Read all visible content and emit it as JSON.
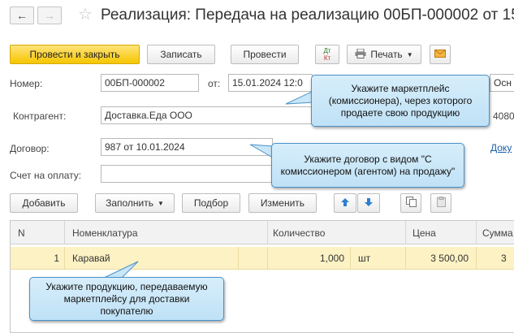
{
  "nav": {
    "back_icon": "arrow-left-icon",
    "forward_icon": "arrow-right-icon",
    "star_icon": "star-icon"
  },
  "window": {
    "title": "Реализация: Передача на реализацию 00БП-000002 от 15"
  },
  "toolbar": {
    "post_close_label": "Провести и закрыть",
    "save_label": "Записать",
    "post_label": "Провести",
    "dt_kt_top": "Дт",
    "dt_kt_bottom": "Кт",
    "print_label": "Печать",
    "print_icon": "printer-icon",
    "mail_icon": "envelope-icon"
  },
  "form": {
    "number_label": "Номер:",
    "number_value": "00БП-000002",
    "from_label": "от:",
    "date_value": "15.01.2024 12:0",
    "org_value": "Осн",
    "counterparty_label": "Контрагент:",
    "counterparty_value": "Доставка.Еда ООО",
    "counterparty_extra": "4080",
    "contract_label": "Договор:",
    "contract_value": "987 от 10.01.2024",
    "contract_link": "Доку",
    "invoice_label": "Счет на оплату:",
    "invoice_value": ""
  },
  "table_toolbar": {
    "add_label": "Добавить",
    "fill_label": "Заполнить",
    "select_label": "Подбор",
    "edit_label": "Изменить",
    "up_icon": "arrow-up-icon",
    "down_icon": "arrow-down-icon",
    "copy_icon": "copy-icon",
    "paste_icon": "paste-icon"
  },
  "table": {
    "headers": {
      "n": "N",
      "item": "Номенклатура",
      "qty": "Количество",
      "price": "Цена",
      "sum": "Сумма"
    },
    "rows": [
      {
        "n": "1",
        "item": "Каравай",
        "qty": "1,000",
        "unit": "шт",
        "price": "3 500,00",
        "sum": "3"
      }
    ]
  },
  "callouts": {
    "marketplace": "Укажите маркетплейс (комиссионера), через которого продаете свою продукцию",
    "contract": "Укажите договор с видом \"С комиссионером (агентом) на продажу\"",
    "product": "Укажите продукцию, передаваемую маркетплейсу для доставки покупателю"
  },
  "colors": {
    "primary_button": "#f6c600",
    "selected_row": "#fdf2c4",
    "callout_bg": "#c9e7f8",
    "callout_border": "#4b91c8",
    "link": "#1a5fa8"
  }
}
